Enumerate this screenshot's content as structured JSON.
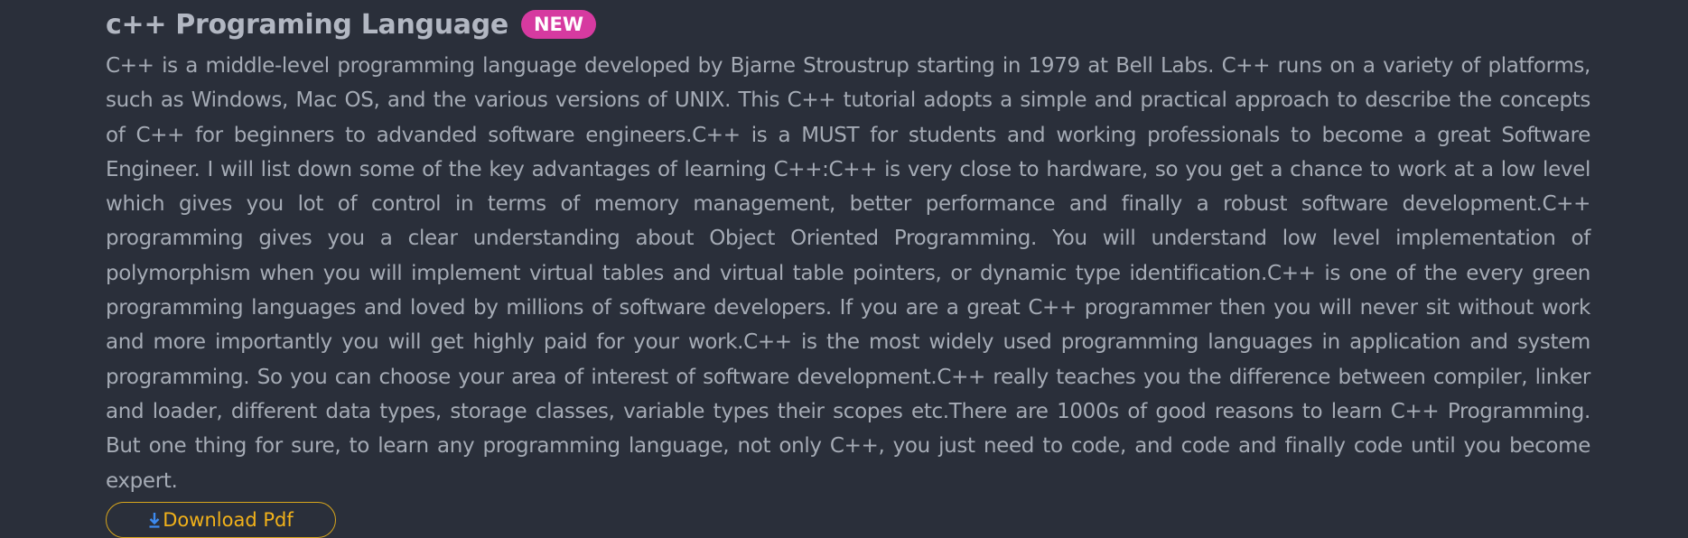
{
  "course": {
    "title": "c++ Programing Language",
    "badge": "NEW",
    "description": "C++ is a middle-level programming language developed by Bjarne Stroustrup starting in 1979 at Bell Labs. C++ runs on a variety of platforms, such as Windows, Mac OS, and the various versions of UNIX. This C++ tutorial adopts a simple and practical approach to describe the concepts of C++ for beginners to advanded software engineers.C++ is a MUST for students and working professionals to become a great Software Engineer. I will list down some of the key advantages of learning C++:C++ is very close to hardware, so you get a chance to work at a low level which gives you lot of control in terms of memory management, better performance and finally a robust software development.C++ programming gives you a clear understanding about Object Oriented Programming. You will understand low level implementation of polymorphism when you will implement virtual tables and virtual table pointers, or dynamic type identification.C++ is one of the every green programming languages and loved by millions of software developers. If you are a great C++ programmer then you will never sit without work and more importantly you will get highly paid for your work.C++ is the most widely used programming languages in application and system programming. So you can choose your area of interest of software development.C++ really teaches you the difference between compiler, linker and loader, different data types, storage classes, variable types their scopes etc.There are 1000s of good reasons to learn C++ Programming. But one thing for sure, to learn any programming language, not only C++, you just need to code, and code and finally code until you become expert.",
    "download_label": "Download Pdf",
    "download_icon": "download-arrow-icon"
  },
  "colors": {
    "background": "#2a2f3a",
    "title": "#b2b7c2",
    "text": "#a5abb5",
    "badge_bg": "#d63aa0",
    "button_border": "#d8a61c",
    "button_text": "#f2b21a",
    "icon": "#3d8bf0"
  }
}
